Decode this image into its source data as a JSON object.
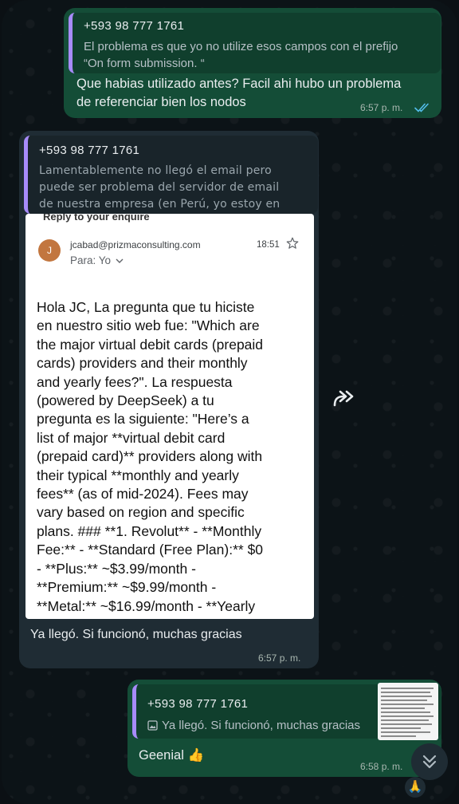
{
  "messages": {
    "top": {
      "quote_sender": "+593 98 777 1761",
      "quote_line1": "El problema es que yo no utilize esos campos con el prefijo",
      "quote_line2": "“On form submission. “",
      "text_line1": "Que habias utilizado antes? Facil ahi hubo un problema",
      "text_line2": "de referenciar bien los nodos",
      "time": "6:57 p. m.",
      "status_icon": "double-check-read-icon"
    },
    "middle": {
      "quote_sender": "+593 98 777 1761",
      "quote_line1": "Lamentablemente no llegó el email pero",
      "quote_line2": "puede ser problema del servidor de email",
      "quote_line3": "de nuestra empresa (en Perú, yo estoy en Ecu...",
      "caption": "Ya llegó. Si funcionó, muchas gracias",
      "time": "6:57 p. m."
    },
    "bottom": {
      "quote_sender": "+593 98 777 1761",
      "quote_text": "Ya llegó. Si funcionó, muchas gracias",
      "text": "Geenial 👍",
      "time": "6:58 p. m."
    }
  },
  "email": {
    "subject": "Reply to your enquire",
    "avatar_letter": "J",
    "from": "jcabad@prizmaconsulting.com",
    "to": "Para: Yo",
    "time": "18:51",
    "body": [
      "Hola JC, La pregunta que tu hiciste",
      "en nuestro sitio web fue: \"Which are",
      "the major virtual debit cards (prepaid",
      "cards) providers and their monthly",
      "and yearly fees?\". La respuesta",
      "(powered by DeepSeek) a tu",
      "pregunta es la siguiente: \"Here’s a",
      "list of major **virtual debit card",
      "(prepaid card)** providers along with",
      "their typical **monthly and yearly",
      "fees** (as of mid-2024). Fees may",
      "vary based on region and specific",
      "plans. ### **1. Revolut** - **Monthly",
      "Fee:** - **Standard (Free Plan):** $0",
      "- **Plus:** ~$3.99/month -",
      "**Premium:** ~$9.99/month -",
      "**Metal:** ~$16.99/month - **Yearly"
    ]
  },
  "reaction": "🙏",
  "colors": {
    "outgoing_bubble": "#144d37",
    "incoming_bubble": "#1f2c34",
    "quote_bar": "#a78bfa",
    "read_ticks": "#53bdeb"
  }
}
